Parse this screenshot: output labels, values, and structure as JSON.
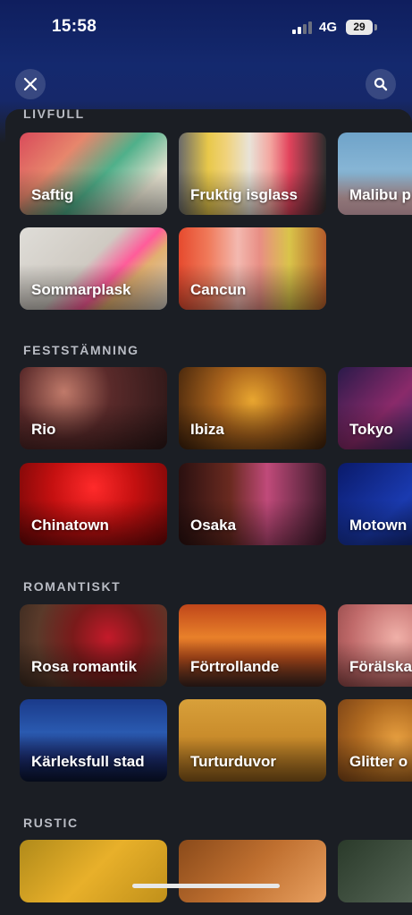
{
  "status_bar": {
    "time": "15:58",
    "network": "4G",
    "battery": "29"
  },
  "sections": [
    {
      "title": "LIVFULL",
      "rows": [
        [
          "Saftig",
          "Fruktig isglass",
          "Malibu p"
        ],
        [
          "Sommarplask",
          "Cancun"
        ]
      ]
    },
    {
      "title": "FESTSTÄMNING",
      "rows": [
        [
          "Rio",
          "Ibiza",
          "Tokyo"
        ],
        [
          "Chinatown",
          "Osaka",
          "Motown"
        ]
      ]
    },
    {
      "title": "ROMANTISKT",
      "rows": [
        [
          "Rosa romantik",
          "Förtrollande",
          "Förälska"
        ],
        [
          "Kärleksfull stad",
          "Turturduvor",
          "Glitter o"
        ]
      ]
    },
    {
      "title": "RUSTIC",
      "rows": []
    }
  ],
  "icons": {
    "close": "close-icon",
    "search": "search-icon"
  }
}
